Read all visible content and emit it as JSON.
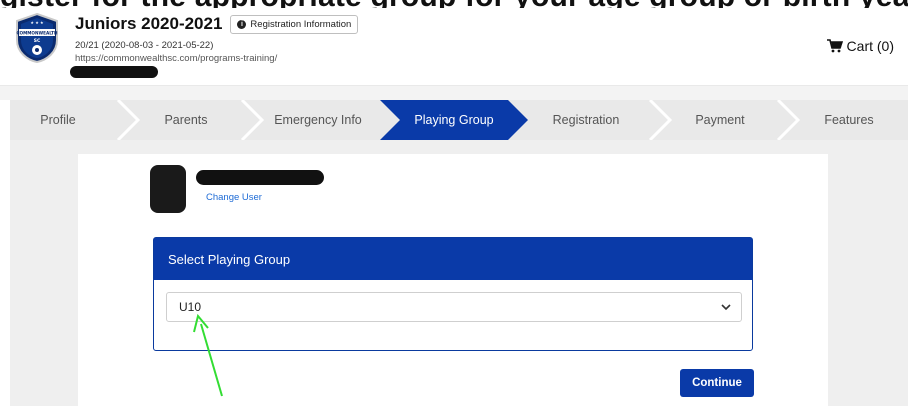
{
  "cut_heading": "gister for the appropriate group for your age group or birth year",
  "header": {
    "program_title": "Juniors 2020-2021",
    "registration_info_button": "Registration Information",
    "season_line": "20/21 (2020-08-03 - 2021-05-22)",
    "url": "https://commonwealthsc.com/programs-training/",
    "cart_label": "Cart (0)",
    "logo_text": "COMMONWEALTH",
    "logo_sub": "SC"
  },
  "steps": [
    {
      "label": "Profile",
      "active": false
    },
    {
      "label": "Parents",
      "active": false
    },
    {
      "label": "Emergency Info",
      "active": false
    },
    {
      "label": "Playing Group",
      "active": true
    },
    {
      "label": "Registration",
      "active": false
    },
    {
      "label": "Payment",
      "active": false
    },
    {
      "label": "Features",
      "active": false
    }
  ],
  "user": {
    "change_user_label": "Change User"
  },
  "playing_group": {
    "card_title": "Select Playing Group",
    "selected_value": "U10"
  },
  "actions": {
    "continue_label": "Continue"
  },
  "colors": {
    "primary": "#0a3aa8",
    "link": "#1e6bd6",
    "annotation_arrow": "#33dd33"
  }
}
